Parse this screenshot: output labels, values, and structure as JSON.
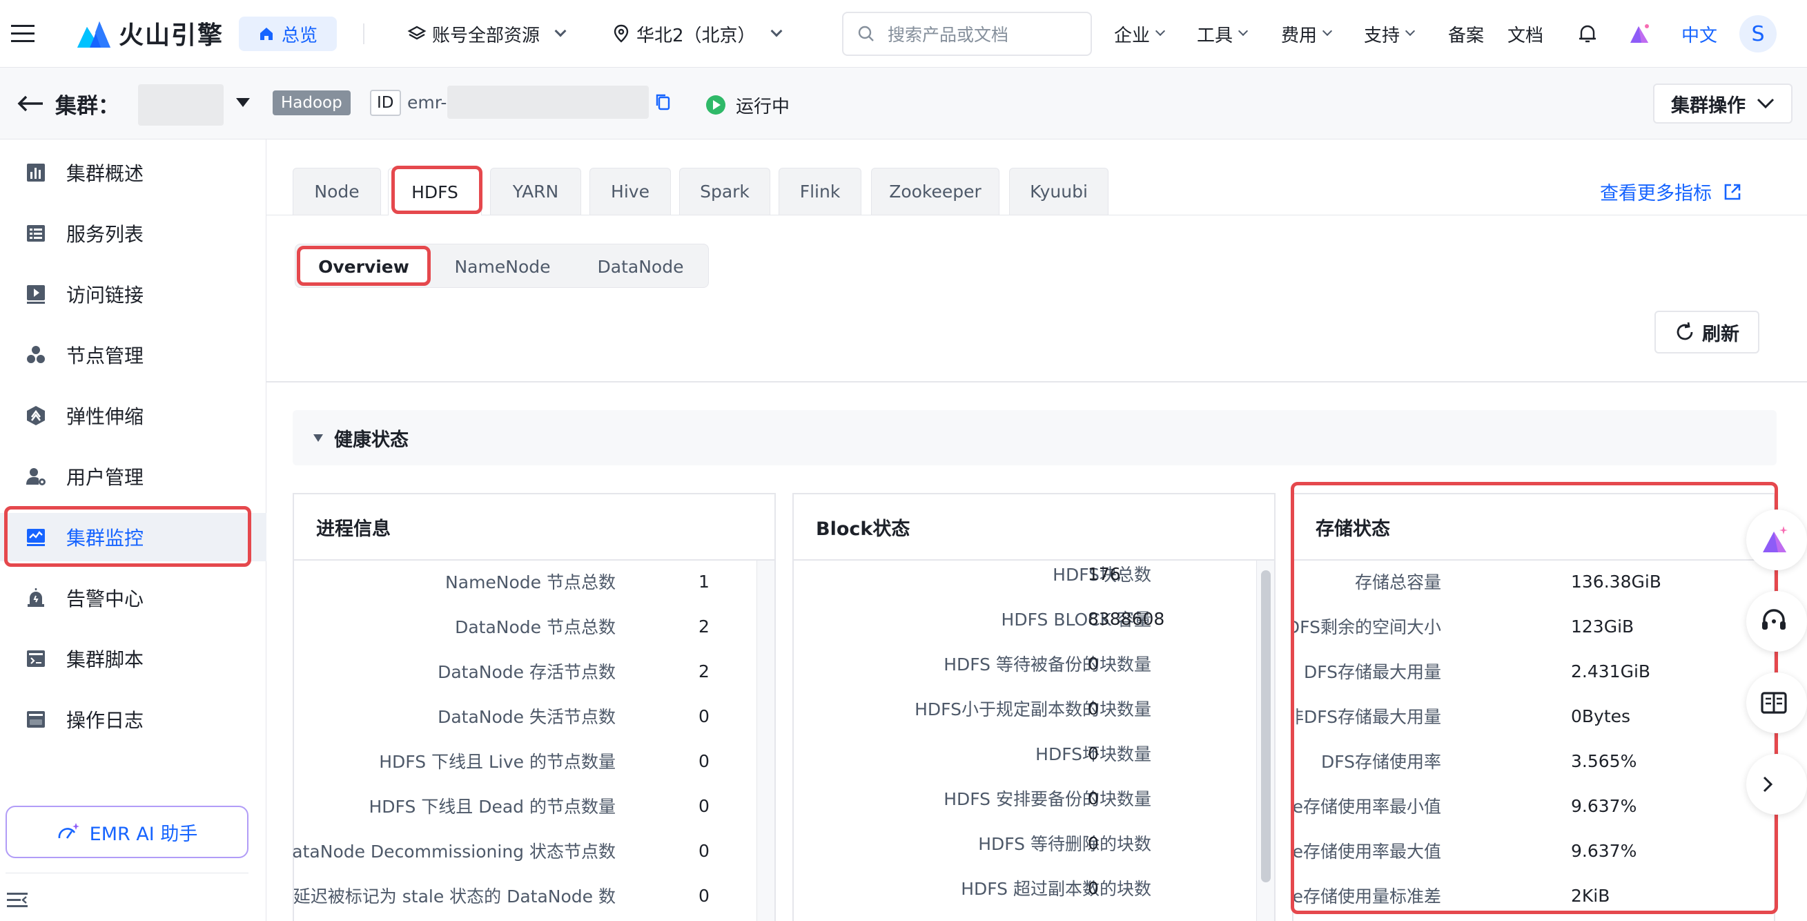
{
  "topnav": {
    "logo_text": "火山引擎",
    "home": "总览",
    "account_scope": "账号全部资源",
    "region": "华北2（北京）",
    "search_placeholder": "搜索产品或文档",
    "menus": [
      "企业",
      "工具",
      "费用",
      "支持"
    ],
    "links": [
      "备案",
      "文档"
    ],
    "language": "中文",
    "avatar_initial": "S"
  },
  "cluster": {
    "label": "集群：",
    "tag": "Hadoop",
    "id_label": "ID",
    "id_prefix": "emr-",
    "status": "运行中",
    "actions_button": "集群操作"
  },
  "sidebar": {
    "items": [
      {
        "label": "集群概述",
        "icon": "chart-bar-icon"
      },
      {
        "label": "服务列表",
        "icon": "list-icon"
      },
      {
        "label": "访问链接",
        "icon": "link-play-icon"
      },
      {
        "label": "节点管理",
        "icon": "nodes-icon"
      },
      {
        "label": "弹性伸缩",
        "icon": "scaling-icon"
      },
      {
        "label": "用户管理",
        "icon": "user-gear-icon"
      },
      {
        "label": "集群监控",
        "icon": "monitor-icon"
      },
      {
        "label": "告警中心",
        "icon": "alarm-icon"
      },
      {
        "label": "集群脚本",
        "icon": "script-icon"
      },
      {
        "label": "操作日志",
        "icon": "log-icon"
      }
    ],
    "active_index": 6,
    "ai_button": "EMR AI 助手"
  },
  "service_tabs": [
    "Node",
    "HDFS",
    "YARN",
    "Hive",
    "Spark",
    "Flink",
    "Zookeeper",
    "Kyuubi"
  ],
  "active_service_tab": "HDFS",
  "more_metrics_link": "查看更多指标",
  "sub_tabs": [
    "Overview",
    "NameNode",
    "DataNode"
  ],
  "active_sub_tab": "Overview",
  "refresh_button": "刷新",
  "health_section": "健康状态",
  "panels": {
    "process": {
      "title": "进程信息",
      "rows": [
        {
          "k": "NameNode 节点总数",
          "v": "1"
        },
        {
          "k": "DataNode 节点总数",
          "v": "2"
        },
        {
          "k": "DataNode 存活节点数",
          "v": "2"
        },
        {
          "k": "DataNode 失活节点数",
          "v": "0"
        },
        {
          "k": "HDFS 下线且 Live 的节点数量",
          "v": "0"
        },
        {
          "k": "HDFS 下线且 Dead 的节点数量",
          "v": "0"
        },
        {
          "k": "DataNode Decommissioning 状态节点数",
          "v": "0"
        },
        {
          "k": "心跳延迟被标记为 stale 状态的 DataNode 数",
          "v": "0"
        }
      ]
    },
    "block": {
      "title": "Block状态",
      "rows": [
        {
          "k": "HDFS块总数",
          "v": "176"
        },
        {
          "k": "HDFS BLOCK 容量",
          "v": "8388608"
        },
        {
          "k": "HDFS 等待被备份的块数量",
          "v": "0"
        },
        {
          "k": "HDFS小于规定副本数的块数量",
          "v": "0"
        },
        {
          "k": "HDFS坏块数量",
          "v": "0"
        },
        {
          "k": "HDFS 安排要备份的块数量",
          "v": "0"
        },
        {
          "k": "HDFS 等待删除的块数",
          "v": "0"
        },
        {
          "k": "HDFS 超过副本数的块数",
          "v": "0"
        }
      ]
    },
    "storage": {
      "title": "存储状态",
      "rows": [
        {
          "k": "存储总容量",
          "v": "136.38GiB"
        },
        {
          "k": "HDFS剩余的空间大小",
          "v": "123GiB"
        },
        {
          "k": "DFS存储最大用量",
          "v": "2.431GiB"
        },
        {
          "k": "非DFS存储最大用量",
          "v": "0Bytes"
        },
        {
          "k": "DFS存储使用率",
          "v": "3.565%"
        },
        {
          "k": "Datanode存储使用率最小值",
          "v": "9.637%"
        },
        {
          "k": "Datanode存储使用率最大值",
          "v": "9.637%"
        },
        {
          "k": "Datanode存储使用量标准差",
          "v": "2KiB"
        }
      ]
    }
  },
  "colors": {
    "primary": "#1664ff",
    "highlight_border": "#e5484d",
    "running": "#2fb968"
  }
}
